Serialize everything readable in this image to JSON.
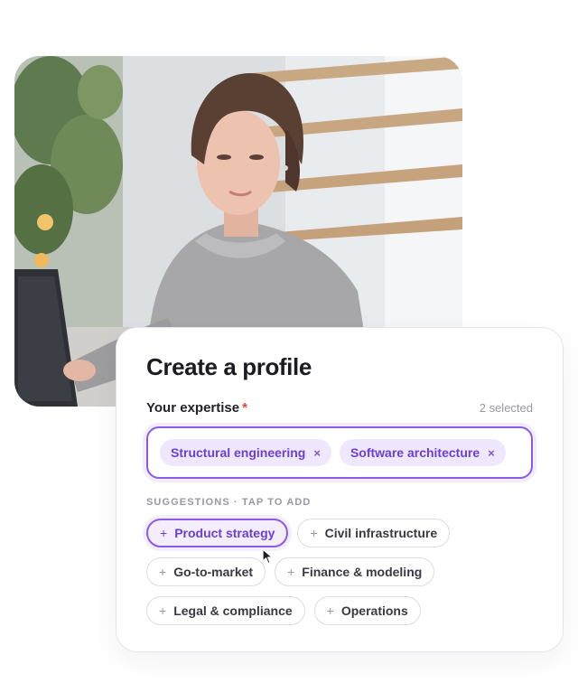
{
  "profile_card": {
    "title": "Create a profile",
    "expertise_label": "Your expertise",
    "required_marker": "*",
    "selected_count": "2 selected",
    "selected_tags": [
      {
        "label": "Structural engineering",
        "remove": "×"
      },
      {
        "label": "Software architecture",
        "remove": "×"
      }
    ],
    "suggestions_label": "SUGGESTIONS · TAP TO ADD",
    "suggestions": [
      {
        "plus": "+",
        "label": "Product strategy",
        "state": "hover"
      },
      {
        "plus": "+",
        "label": "Civil infrastructure"
      },
      {
        "plus": "+",
        "label": "Go-to-market"
      },
      {
        "plus": "+",
        "label": "Finance & modeling"
      },
      {
        "plus": "+",
        "label": "Legal & compliance"
      },
      {
        "plus": "+",
        "label": "Operations"
      }
    ]
  },
  "colors": {
    "accent": "#8a5ae8",
    "accent_text": "#6a3fd4",
    "tag_bg": "#efe8fd",
    "required": "#e0453a"
  },
  "icons": {
    "remove_tag": "close-icon",
    "add_suggestion": "plus-icon",
    "pointer": "mouse-cursor-icon"
  }
}
